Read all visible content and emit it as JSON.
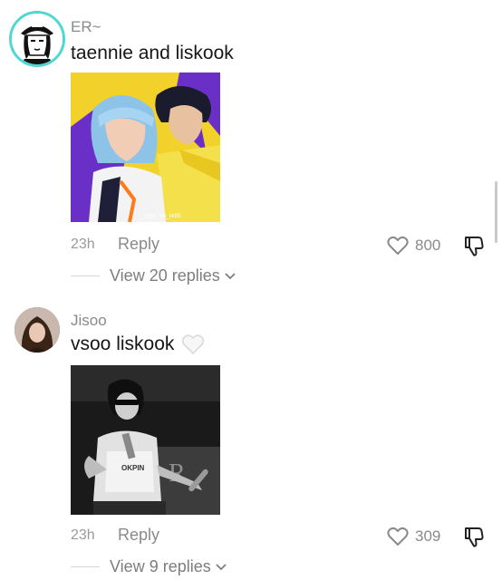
{
  "comments": [
    {
      "username": "ER~",
      "text": "taennie and liskook",
      "time": "23h",
      "reply_label": "Reply",
      "likes": "800",
      "view_replies": "View 20 replies",
      "image_watermark": "@lis_me_kk85"
    },
    {
      "username": "Jisoo",
      "text": "vsoo liskook",
      "emoji": "white-heart",
      "time": "23h",
      "reply_label": "Reply",
      "likes": "309",
      "view_replies": "View 9 replies",
      "image_overlay_text": "OKPIN"
    }
  ],
  "icons": [
    "heart-outline-icon",
    "dislike-icon",
    "chevron-down-icon"
  ],
  "colors": {
    "avatar_ring": "#4fd7d2",
    "secondary_text": "#8a8a8a",
    "primary_text": "#161616",
    "image1_background": "#f2d22a",
    "image1_purple": "#6a2fc6"
  }
}
